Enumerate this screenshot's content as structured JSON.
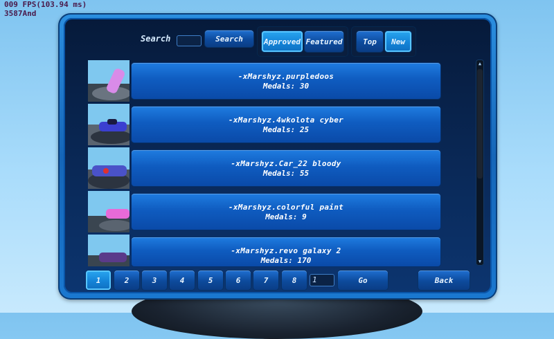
{
  "debug": {
    "fps": "009 FPS(103.94 ms)",
    "id": "3587And"
  },
  "search": {
    "label": "Search",
    "value": "",
    "button": "Search"
  },
  "filters": {
    "approved": "Approved",
    "featured": "Featured",
    "top": "Top",
    "new": "New"
  },
  "items": [
    {
      "title": "-xMarshyz.purpledoos",
      "medals": "Medals: 30",
      "car_color": "#d98be8"
    },
    {
      "title": "-xMarshyz.4wkolota cyber",
      "medals": "Medals: 25",
      "car_color": "#3b3fd0"
    },
    {
      "title": "-xMarshyz.Car_22 bloody",
      "medals": "Medals: 55",
      "car_color": "#4a52c8"
    },
    {
      "title": "-xMarshyz.colorful paint",
      "medals": "Medals: 9",
      "car_color": "#e86ad8"
    },
    {
      "title": "-xMarshyz.revo galaxy 2",
      "medals": "Medals: 170",
      "car_color": "#5a3a8a"
    }
  ],
  "pagination": {
    "pages": [
      "1",
      "2",
      "3",
      "4",
      "5",
      "6",
      "7",
      "8"
    ],
    "current": "1",
    "page_input": "1",
    "go": "Go",
    "back": "Back"
  }
}
